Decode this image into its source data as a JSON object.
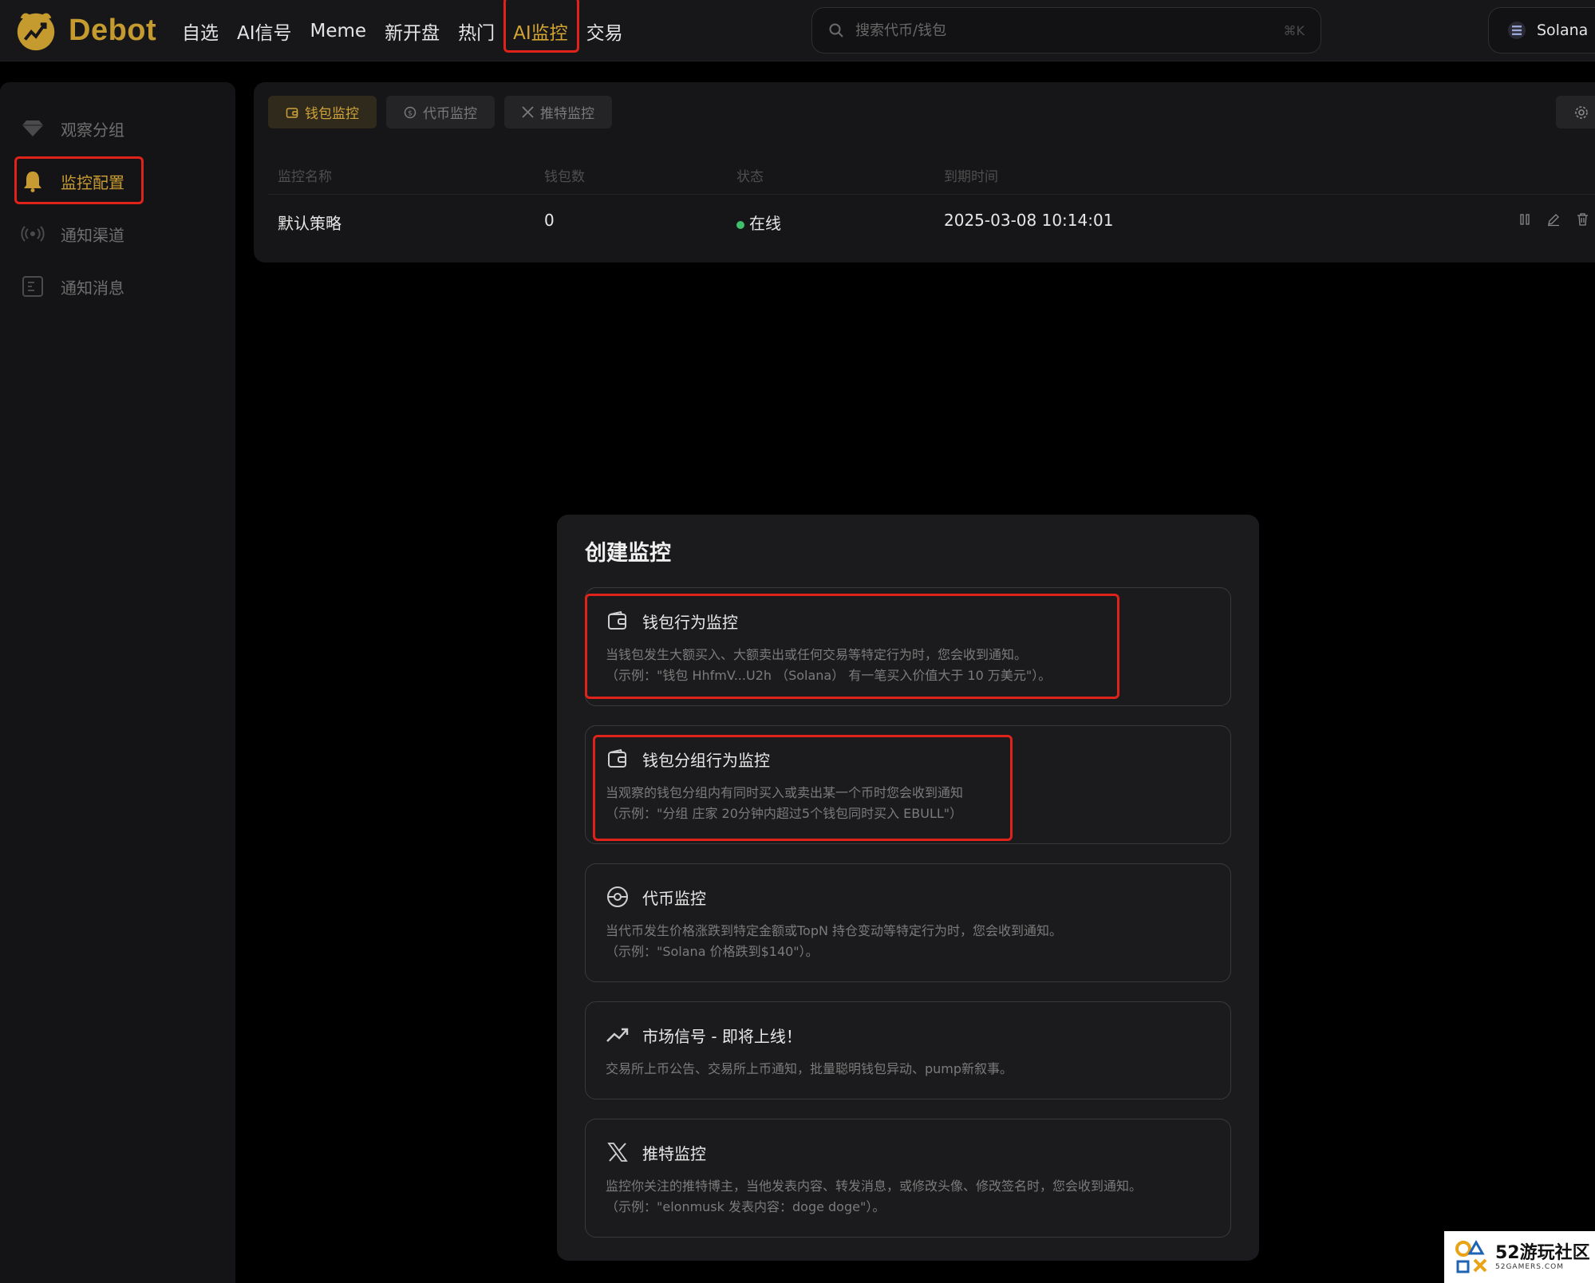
{
  "brand": {
    "name": "Debot",
    "accent": "#c59a2e",
    "highlight": "#e0231a"
  },
  "nav": {
    "items": [
      "自选",
      "AI信号",
      "Meme",
      "新开盘",
      "热门",
      "AI监控",
      "交易"
    ],
    "active": "AI监控"
  },
  "search": {
    "placeholder": "搜索代币/钱包",
    "shortcut": "⌘K"
  },
  "chain": {
    "label": "Solana",
    "icon": "solana-icon"
  },
  "sidebar": {
    "items": [
      {
        "label": "观察分组",
        "icon": "diamond-icon"
      },
      {
        "label": "监控配置",
        "icon": "bell-icon",
        "active": true
      },
      {
        "label": "通知渠道",
        "icon": "broadcast-icon"
      },
      {
        "label": "通知消息",
        "icon": "message-list-icon"
      }
    ]
  },
  "tabs": [
    {
      "label": "钱包监控",
      "icon": "wallet-icon",
      "active": true
    },
    {
      "label": "代币监控",
      "icon": "coin-icon"
    },
    {
      "label": "推特监控",
      "icon": "x-logo-icon"
    }
  ],
  "table": {
    "headers": [
      "监控名称",
      "钱包数",
      "状态",
      "到期时间"
    ],
    "rows": [
      {
        "name": "默认策略",
        "wallets": "0",
        "status": "在线",
        "expires": "2025-03-08 10:14:01"
      }
    ]
  },
  "modal": {
    "title": "创建监控",
    "cards": [
      {
        "title": "钱包行为监控",
        "icon": "wallet-icon",
        "desc1": "当钱包发生大额买入、大额卖出或任何交易等特定行为时，您会收到通知。",
        "desc2": "（示例：\"钱包 HhfmV...U2h （Solana） 有一笔买入价值大于 10 万美元\"）。"
      },
      {
        "title": "钱包分组行为监控",
        "icon": "wallet-icon",
        "desc1": "当观察的钱包分组内有同时买入或卖出某一个币时您会收到通知",
        "desc2": "（示例：\"分组 庄家 20分钟内超过5个钱包同时买入 EBULL\"）"
      },
      {
        "title": "代币监控",
        "icon": "coin-target-icon",
        "desc1": "当代币发生价格涨跌到特定金额或TopN 持仓变动等特定行为时，您会收到通知。",
        "desc2": "（示例：\"Solana 价格跌到$140\"）。"
      },
      {
        "title": "市场信号 - 即将上线！",
        "icon": "trend-up-icon",
        "desc1": "交易所上币公告、交易所上币通知，批量聪明钱包异动、pump新叙事。",
        "desc2": ""
      },
      {
        "title": "推特监控",
        "icon": "x-logo-icon",
        "desc1": "监控你关注的推特博主，当他发表内容、转发消息，或修改头像、修改签名时，您会收到通知。",
        "desc2": "（示例：\"elonmusk 发表内容：doge doge\"）。"
      }
    ]
  },
  "watermark": {
    "title": "52游玩社区",
    "subtitle": "52GAMERS.COM"
  }
}
